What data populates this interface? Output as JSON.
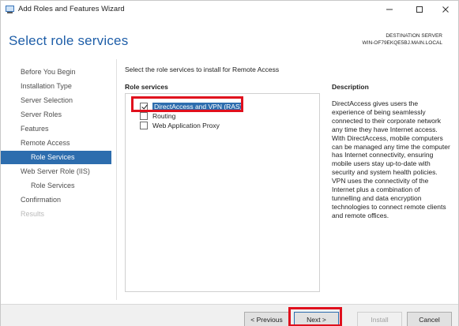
{
  "window": {
    "title": "Add Roles and Features Wizard"
  },
  "header": {
    "page_title": "Select role services",
    "destination_label": "DESTINATION SERVER",
    "destination_value": "WIN-OF79EKQE5BJ.MAIN.LOCAL"
  },
  "nav": {
    "items": [
      {
        "label": "Before You Begin",
        "state": "normal"
      },
      {
        "label": "Installation Type",
        "state": "normal"
      },
      {
        "label": "Server Selection",
        "state": "normal"
      },
      {
        "label": "Server Roles",
        "state": "normal"
      },
      {
        "label": "Features",
        "state": "normal"
      },
      {
        "label": "Remote Access",
        "state": "normal"
      },
      {
        "label": "Role Services",
        "state": "selected"
      },
      {
        "label": "Web Server Role (IIS)",
        "state": "normal"
      },
      {
        "label": "Role Services",
        "state": "normal"
      },
      {
        "label": "Confirmation",
        "state": "normal"
      },
      {
        "label": "Results",
        "state": "disabled"
      }
    ]
  },
  "content": {
    "instruction": "Select the role services to install for Remote Access",
    "role_services_heading": "Role services",
    "description_heading": "Description",
    "roles": [
      {
        "label": "DirectAccess and VPN (RAS)",
        "checked": true
      },
      {
        "label": "Routing",
        "checked": false
      },
      {
        "label": "Web Application Proxy",
        "checked": false
      }
    ],
    "description": "DirectAccess gives users the experience of being seamlessly connected to their corporate network any time they have Internet access. With DirectAccess, mobile computers can be managed any time the computer has Internet connectivity, ensuring mobile users stay up-to-date with security and system health policies. VPN uses the connectivity of the Internet plus a combination of tunnelling and data encryption technologies to connect remote clients and remote offices."
  },
  "footer": {
    "previous_label": "< Previous",
    "next_label": "Next >",
    "install_label": "Install",
    "cancel_label": "Cancel"
  },
  "colors": {
    "accent": "#2d6dae",
    "title_blue": "#1e5ea8",
    "annotation_red": "#e0101d"
  }
}
